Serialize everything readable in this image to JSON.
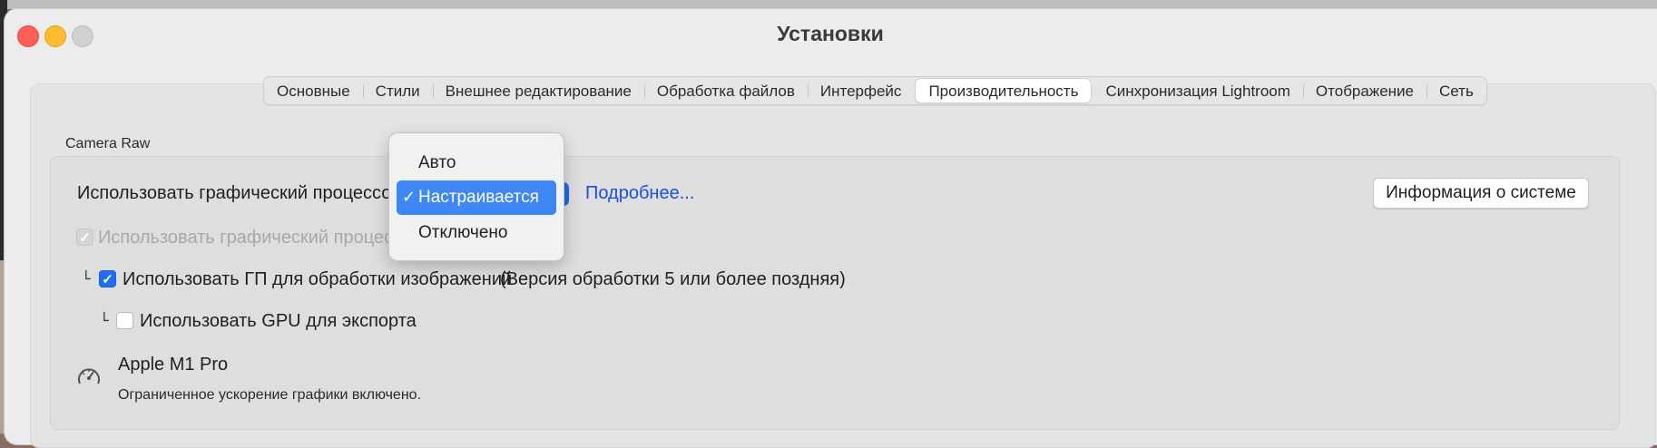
{
  "window": {
    "title": "Установки"
  },
  "tabs": [
    {
      "label": "Основные",
      "active": false
    },
    {
      "label": "Стили",
      "active": false
    },
    {
      "label": "Внешнее редактирование",
      "active": false
    },
    {
      "label": "Обработка файлов",
      "active": false
    },
    {
      "label": "Интерфейс",
      "active": false
    },
    {
      "label": "Производительность",
      "active": true
    },
    {
      "label": "Синхронизация Lightroom",
      "active": false
    },
    {
      "label": "Отображение",
      "active": false
    },
    {
      "label": "Сеть",
      "active": false
    }
  ],
  "camera_raw": {
    "section_label": "Camera Raw",
    "gpu_label": "Использовать графический процессор:",
    "more_link": "Подробнее...",
    "system_info_button": "Информация о системе",
    "dim_option_text": "Использовать графический процессо",
    "gp_image_processing": {
      "label": "Использовать ГП для обработки изображений",
      "note": "(Версия обработки 5 или более поздняя)",
      "checked": true
    },
    "gpu_export": {
      "label": "Использовать GPU для экспорта",
      "checked": false
    },
    "tree_marker": "└",
    "gpu_name": "Apple M1 Pro",
    "gpu_status": "Ограниченное ускорение графики включено."
  },
  "dropdown": {
    "options": [
      "Авто",
      "Настраивается",
      "Отключено"
    ],
    "selected": "Настраивается",
    "check_glyph": "✓"
  },
  "colors": {
    "accent": "#3f87f4",
    "link": "#1d4fd8",
    "close": "#fe5f57",
    "minimize": "#febc2e"
  },
  "icons": {
    "gauge": "gauge-icon",
    "checkmark": "checkmark-icon"
  }
}
